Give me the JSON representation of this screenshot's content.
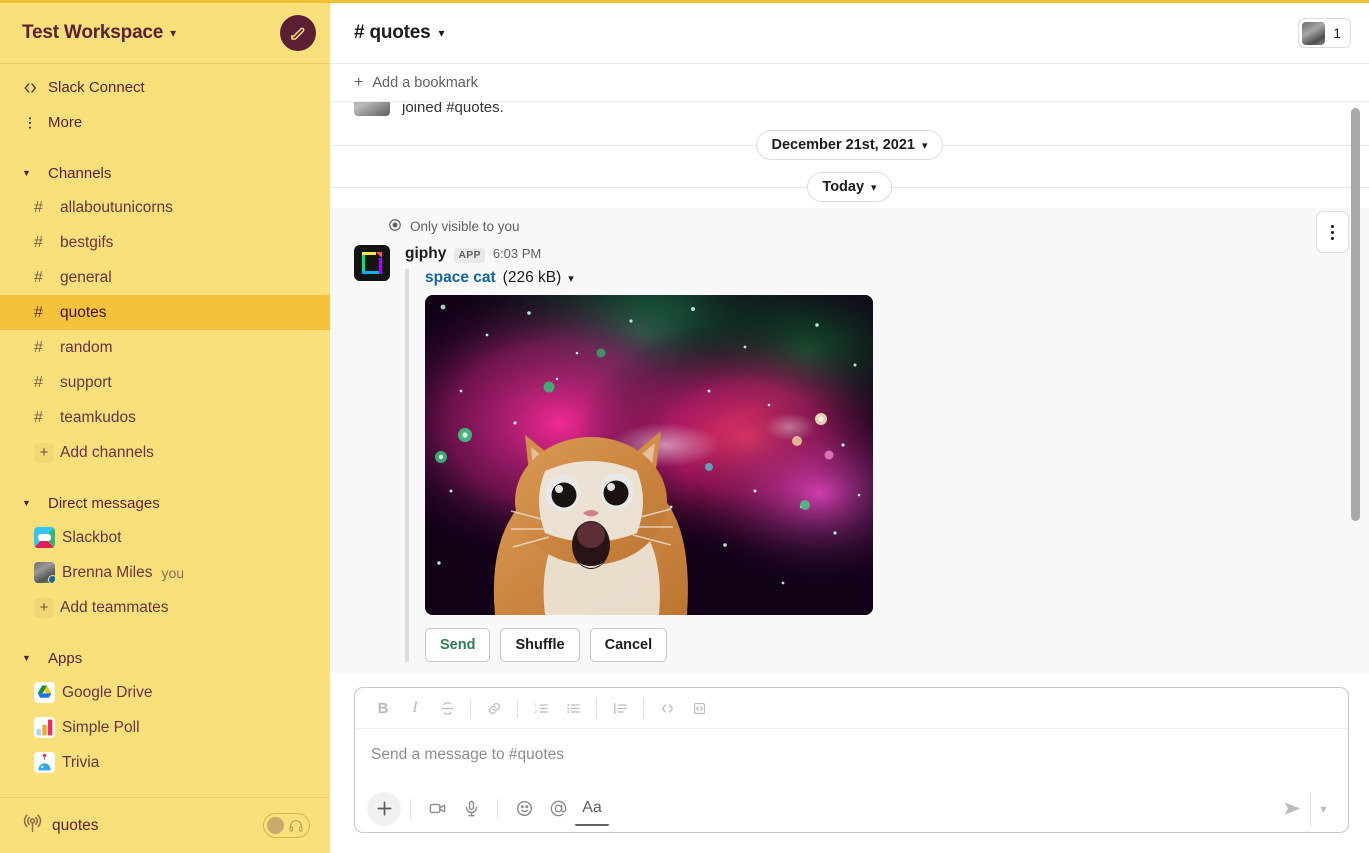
{
  "theme": {
    "sidebar_bg": "#FAE07A",
    "sidebar_text": "#5C1E33",
    "sidebar_active_bg": "#F5C33B",
    "top_accent": "#F0C132",
    "link_blue": "#1264A3",
    "send_green": "#2E7D52",
    "ephemeral_bg": "#F8F8F8"
  },
  "sidebar": {
    "workspace_name": "Test Workspace",
    "workspace_caret_icon": "chevron-down-icon",
    "compose_icon": "compose-pencil-icon",
    "nav": [
      {
        "label": "Slack Connect",
        "icon": "slack-connect-icon"
      },
      {
        "label": "More",
        "icon": "more-vertical-icon"
      }
    ],
    "sections": [
      {
        "label": "Channels",
        "collapsed": false,
        "items": [
          {
            "label": "allaboutunicorns",
            "prefix": "#",
            "active": false
          },
          {
            "label": "bestgifs",
            "prefix": "#",
            "active": false
          },
          {
            "label": "general",
            "prefix": "#",
            "active": false
          },
          {
            "label": "quotes",
            "prefix": "#",
            "active": true
          },
          {
            "label": "random",
            "prefix": "#",
            "active": false
          },
          {
            "label": "support",
            "prefix": "#",
            "active": false
          },
          {
            "label": "teamkudos",
            "prefix": "#",
            "active": false
          }
        ],
        "add_label": "Add channels"
      },
      {
        "label": "Direct messages",
        "collapsed": false,
        "dms": [
          {
            "label": "Slackbot",
            "avatar": "slackbot-avatar",
            "tag": ""
          },
          {
            "label": "Brenna Miles",
            "avatar": "user-photo-avatar",
            "tag": "you",
            "presence": "active"
          }
        ],
        "add_label": "Add teammates"
      },
      {
        "label": "Apps",
        "collapsed": false,
        "apps": [
          {
            "label": "Google Drive",
            "icon": "google-drive-icon"
          },
          {
            "label": "Simple Poll",
            "icon": "simple-poll-icon"
          },
          {
            "label": "Trivia",
            "icon": "trivia-icon"
          }
        ]
      }
    ],
    "huddle": {
      "icon": "huddle-broadcast-icon",
      "channel": "quotes",
      "toggle_state": "off",
      "headphones_icon": "headphones-icon"
    }
  },
  "header": {
    "channel_prefix": "#",
    "channel_name": "quotes",
    "title": "# quotes",
    "caret_icon": "chevron-down-icon",
    "members": {
      "count": "1",
      "avatar": "member-photo-avatar"
    }
  },
  "bookmarks": {
    "add_label": "Add a bookmark",
    "plus_icon": "plus-icon"
  },
  "messages": {
    "cut_off_top": "joined #quotes.",
    "dividers": [
      {
        "label": "December 21st, 2021",
        "caret_icon": "chevron-down-icon"
      },
      {
        "label": "Today",
        "caret_icon": "chevron-down-icon"
      }
    ],
    "ephemeral": {
      "visibility_label": "Only visible to you",
      "eye_icon": "eye-icon",
      "kebab_icon": "more-actions-kebab-icon",
      "author": "giphy",
      "app_badge": "APP",
      "timestamp": "6:03 PM",
      "avatar": "giphy-app-avatar",
      "attachment": {
        "file_name": "space cat",
        "file_size": "(226 kB)",
        "caret_icon": "chevron-down-icon",
        "preview_alt": "surprised orange cat in space nebula gif"
      },
      "buttons": [
        {
          "label": "Send",
          "style": "green"
        },
        {
          "label": "Shuffle",
          "style": "default"
        },
        {
          "label": "Cancel",
          "style": "default"
        }
      ]
    }
  },
  "composer": {
    "placeholder": "Send a message to #quotes",
    "value": "",
    "format_buttons": [
      {
        "name": "bold",
        "glyph": "B"
      },
      {
        "name": "italic",
        "glyph": "I"
      },
      {
        "name": "strikethrough",
        "glyph": "S"
      },
      {
        "name": "link",
        "glyph": "link"
      },
      {
        "name": "ordered-list",
        "glyph": "ol"
      },
      {
        "name": "bulleted-list",
        "glyph": "ul"
      },
      {
        "name": "blockquote",
        "glyph": "quote"
      },
      {
        "name": "code",
        "glyph": "code"
      },
      {
        "name": "code-block",
        "glyph": "code-block"
      }
    ],
    "tools": [
      {
        "name": "plus",
        "label": ""
      },
      {
        "name": "video",
        "label": ""
      },
      {
        "name": "audio",
        "label": ""
      },
      {
        "name": "emoji",
        "label": ""
      },
      {
        "name": "mention",
        "label": ""
      },
      {
        "name": "formatting",
        "label": "Aa"
      }
    ],
    "send_icon": "send-paperplane-icon",
    "send_caret_icon": "chevron-down-icon"
  }
}
